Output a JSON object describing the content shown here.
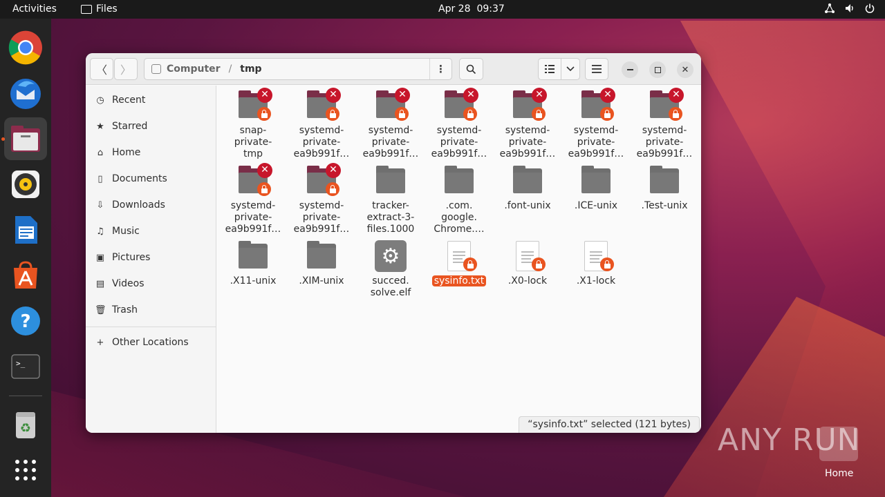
{
  "topbar": {
    "activities": "Activities",
    "app_name": "Files",
    "date": "Apr 28",
    "time": "09:37"
  },
  "dock": {
    "items": [
      "Google Chrome",
      "Thunderbird Mail",
      "Files",
      "Rhythmbox",
      "LibreOffice Writer",
      "Ubuntu Software",
      "Help",
      "Terminal",
      "Trash",
      "Show Applications"
    ]
  },
  "header": {
    "path": [
      "Computer",
      "tmp"
    ],
    "path_separator": "/"
  },
  "sidebar": {
    "items": [
      {
        "label": "Recent",
        "icon": "clock-icon"
      },
      {
        "label": "Starred",
        "icon": "star-icon"
      },
      {
        "label": "Home",
        "icon": "home-icon"
      },
      {
        "label": "Documents",
        "icon": "document-icon"
      },
      {
        "label": "Downloads",
        "icon": "download-icon"
      },
      {
        "label": "Music",
        "icon": "music-icon"
      },
      {
        "label": "Pictures",
        "icon": "picture-icon"
      },
      {
        "label": "Videos",
        "icon": "video-icon"
      },
      {
        "label": "Trash",
        "icon": "trash-icon"
      }
    ],
    "other_locations": "Other Locations"
  },
  "files": [
    {
      "name": "snap-\nprivate-\ntmp",
      "type": "folder-locked"
    },
    {
      "name": "systemd-\nprivate-\nea9b991f…",
      "type": "folder-locked"
    },
    {
      "name": "systemd-\nprivate-\nea9b991f…",
      "type": "folder-locked"
    },
    {
      "name": "systemd-\nprivate-\nea9b991f…",
      "type": "folder-locked"
    },
    {
      "name": "systemd-\nprivate-\nea9b991f…",
      "type": "folder-locked"
    },
    {
      "name": "systemd-\nprivate-\nea9b991f…",
      "type": "folder-locked"
    },
    {
      "name": "systemd-\nprivate-\nea9b991f…",
      "type": "folder-locked"
    },
    {
      "name": "systemd-\nprivate-\nea9b991f…",
      "type": "folder-locked"
    },
    {
      "name": "systemd-\nprivate-\nea9b991f…",
      "type": "folder-locked"
    },
    {
      "name": "tracker-\nextract-3-\nfiles.1000",
      "type": "folder"
    },
    {
      "name": ".com.\ngoogle.\nChrome.…",
      "type": "folder"
    },
    {
      "name": ".font-unix",
      "type": "folder"
    },
    {
      "name": ".ICE-unix",
      "type": "folder"
    },
    {
      "name": ".Test-unix",
      "type": "folder"
    },
    {
      "name": ".X11-unix",
      "type": "folder"
    },
    {
      "name": ".XIM-unix",
      "type": "folder"
    },
    {
      "name": "succed.\nsolve.elf",
      "type": "executable"
    },
    {
      "name": "sysinfo.txt",
      "type": "text-locked",
      "selected": true
    },
    {
      "name": ".X0-lock",
      "type": "text-locked"
    },
    {
      "name": ".X1-lock",
      "type": "text-locked"
    }
  ],
  "status": "“sysinfo.txt” selected  (121 bytes)",
  "desktop": {
    "home_label": "Home",
    "watermark": "ANY RUN"
  },
  "colors": {
    "accent": "#e95420",
    "error_badge": "#c7162b",
    "folder": "#787878",
    "folder_locked_back": "#7a2e48"
  }
}
